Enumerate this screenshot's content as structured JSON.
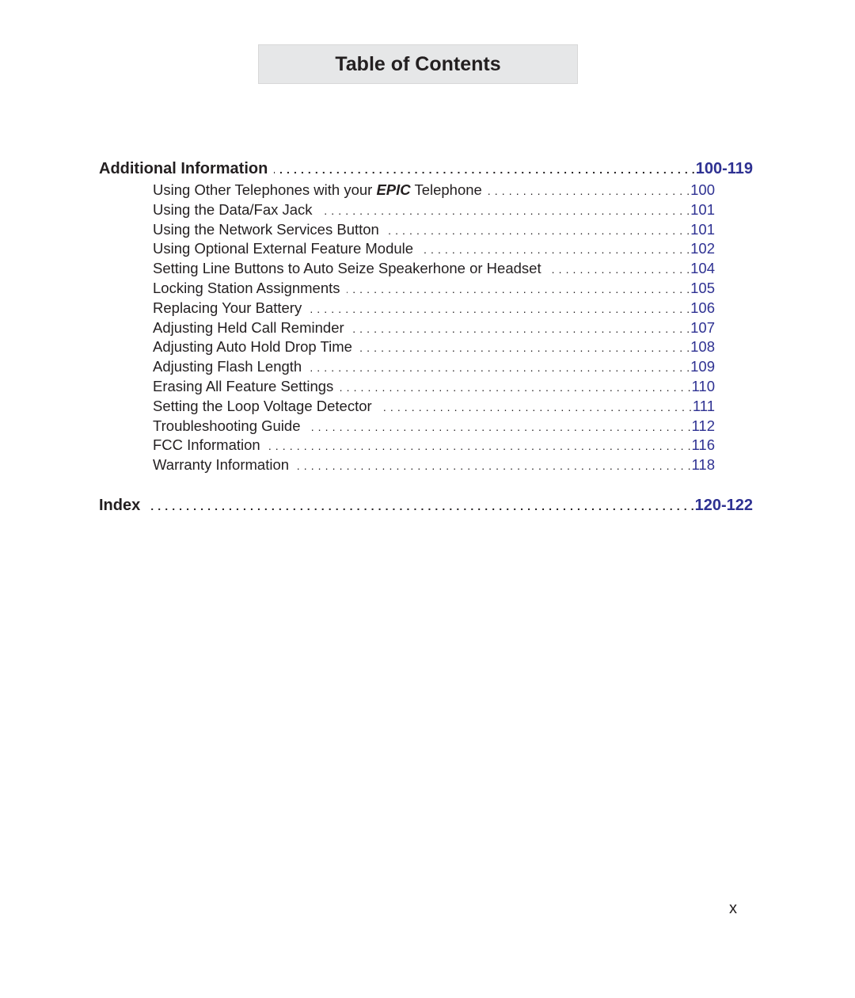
{
  "header": {
    "title": "Table of Contents"
  },
  "colors": {
    "page_number": "#2e3192",
    "text": "#231f20",
    "title_bg": "#e6e7e8"
  },
  "sections": [
    {
      "label": "Additional Information",
      "pages": "100-119",
      "entries": [
        {
          "label_pre": "Using Other Telephones with your ",
          "label_em": "EPIC",
          "label_post": " Telephone",
          "page": "100"
        },
        {
          "label": "Using the Data/Fax Jack",
          "page": "101"
        },
        {
          "label": "Using the Network Services Button",
          "page": "101"
        },
        {
          "label": "Using Optional External Feature Module",
          "page": "102"
        },
        {
          "label": "Setting Line Buttons to Auto Seize Speakerhone or Headset",
          "page": "104"
        },
        {
          "label": "Locking Station Assignments",
          "page": "105"
        },
        {
          "label": "Replacing Your Battery",
          "page": "106"
        },
        {
          "label": "Adjusting Held Call Reminder",
          "page": "107"
        },
        {
          "label": "Adjusting Auto Hold Drop Time",
          "page": "108"
        },
        {
          "label": "Adjusting Flash Length",
          "page": "109"
        },
        {
          "label": "Erasing All Feature Settings",
          "page": "110"
        },
        {
          "label": "Setting the Loop Voltage Detector",
          "page": "111"
        },
        {
          "label": "Troubleshooting Guide",
          "page": "112"
        },
        {
          "label": "FCC Information",
          "page": "116"
        },
        {
          "label": "Warranty Information",
          "page": "118"
        }
      ]
    },
    {
      "label": "Index",
      "pages": "120-122"
    }
  ],
  "footer": {
    "page_number": "x"
  }
}
